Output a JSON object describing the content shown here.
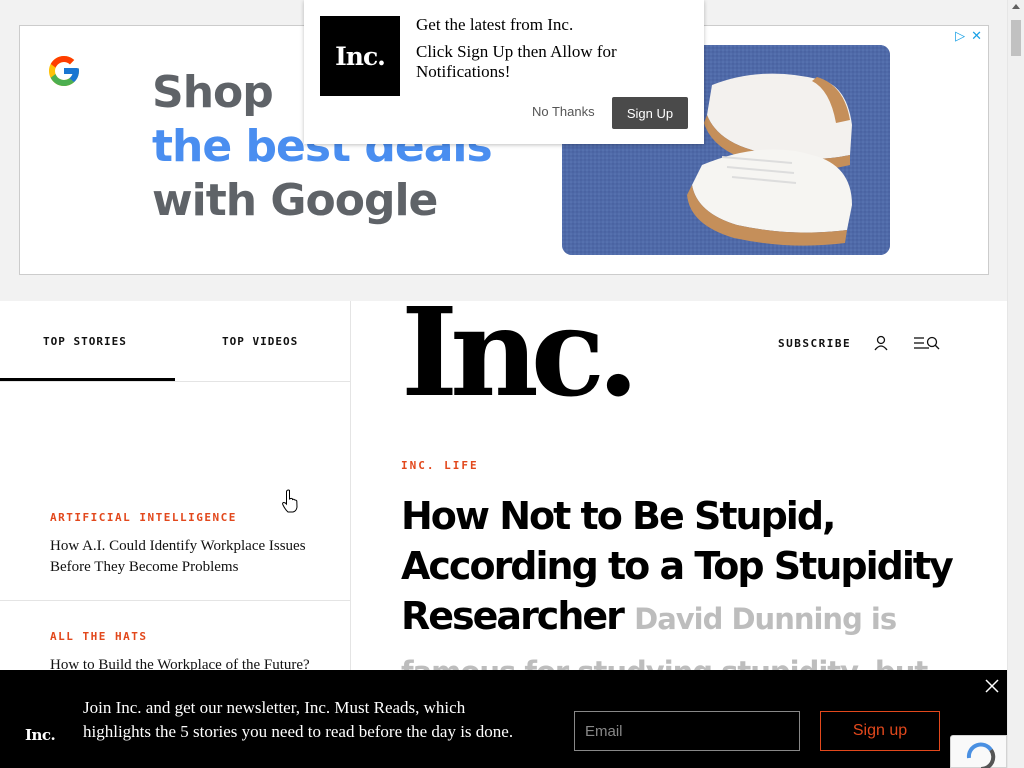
{
  "ad": {
    "line1": "Shop",
    "line2": "the best deals",
    "line3": "with Google",
    "ad_choices_icon": "adchoices-play-icon",
    "close_icon": "close-icon"
  },
  "notification": {
    "logo_text": "Inc.",
    "title": "Get the latest from Inc.",
    "message": "Click Sign Up then Allow for Notifications!",
    "no_thanks": "No Thanks",
    "sign_up": "Sign Up"
  },
  "sidebar": {
    "tabs": [
      {
        "label": "TOP STORIES",
        "active": true
      },
      {
        "label": "TOP VIDEOS",
        "active": false
      }
    ],
    "stories": [
      {
        "category": "ARTIFICIAL INTELLIGENCE",
        "title": "How A.I. Could Identify Workplace Issues Before They Become Problems"
      },
      {
        "category": "ALL THE HATS",
        "title": "How to Build the Workplace of the Future?"
      }
    ]
  },
  "header": {
    "logo": "Inc.",
    "subscribe": "SUBSCRIBE"
  },
  "article": {
    "section": "INC. LIFE",
    "title": "How Not to Be Stupid, According to a Top Stupidity Researcher",
    "dek": "David Dunning is famous for studying stupidity, but his work also"
  },
  "newsletter": {
    "logo": "Inc.",
    "text": "Join Inc. and get our newsletter, Inc. Must Reads, which highlights the 5 stories you need to read before the day is done.",
    "email_placeholder": "Email",
    "sign_up": "Sign up"
  },
  "colors": {
    "accent": "#e2481c",
    "google_blue": "#4a8ef0",
    "google_gray": "#5f6368"
  }
}
